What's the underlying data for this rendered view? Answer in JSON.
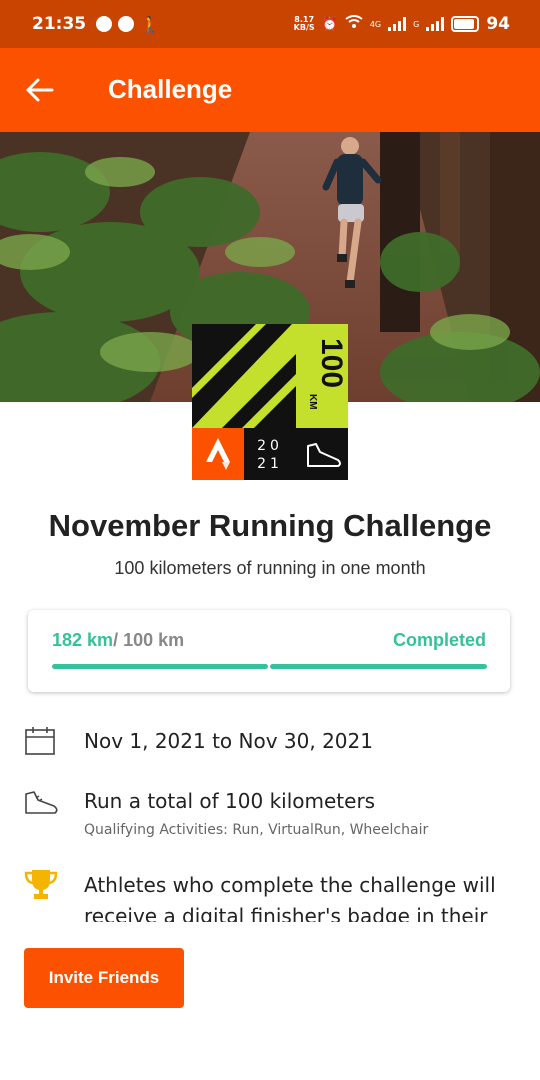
{
  "status_bar": {
    "time": "21:35",
    "speed_value": "8.17",
    "speed_unit": "KB/S",
    "network_1": "4G",
    "network_2": "G",
    "battery": "94"
  },
  "header": {
    "title": "Challenge"
  },
  "badge": {
    "distance": "100",
    "unit": "KM",
    "year_top": "20",
    "year_bottom": "21"
  },
  "challenge": {
    "title": "November Running Challenge",
    "subtitle": "100 kilometers of running in one month"
  },
  "progress": {
    "current": "182 km",
    "goal": "/ 100 km",
    "status": "Completed",
    "fraction": 1.0
  },
  "details": {
    "dates": "Nov 1, 2021 to Nov 30, 2021",
    "requirement": "Run a total of 100 kilometers",
    "qualifying": "Qualifying Activities: Run, VirtualRun, Wheelchair",
    "reward": "Athletes who complete the challenge will receive a digital finisher's badge in their"
  },
  "actions": {
    "invite_label": "Invite Friends"
  },
  "colors": {
    "brand": "#fc5200",
    "status_bar": "#c84400",
    "progress": "#35c29a",
    "badge_lime": "#c5e02c",
    "trophy": "#f5b400"
  },
  "icons": {
    "back": "arrow-left-icon",
    "calendar": "calendar-icon",
    "shoe": "shoe-icon",
    "trophy": "trophy-icon",
    "strava": "strava-logo-icon"
  }
}
